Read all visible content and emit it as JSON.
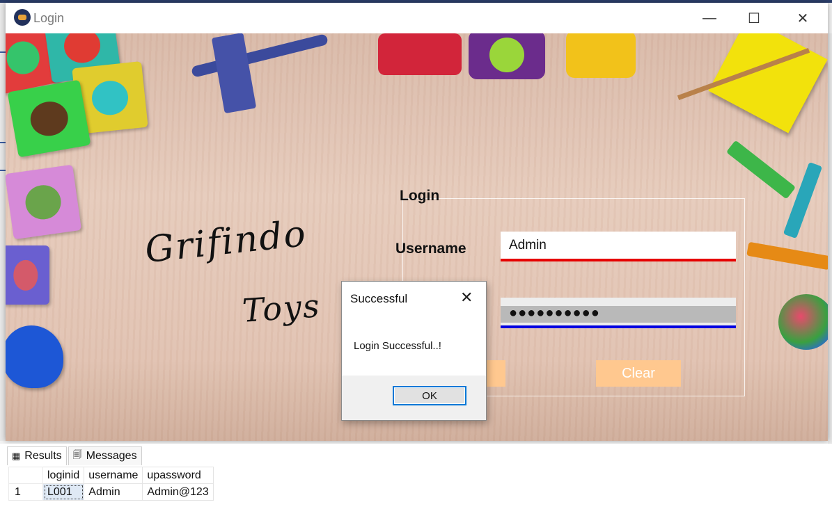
{
  "window": {
    "title": "Login",
    "minimize": "—",
    "maximize": "☐",
    "close": "✕"
  },
  "brand": {
    "line1": "Grifindo",
    "line2": "Toys"
  },
  "login": {
    "group_title": "Login",
    "username_label": "Username",
    "username_value": "Admin",
    "password_mask": "●●●●●●●●●●",
    "clear_label": "Clear",
    "colors": {
      "username_underline": "#e60000",
      "password_underline": "#0000e0",
      "button": "#ffc88f"
    }
  },
  "dialog": {
    "title": "Successful",
    "close": "✕",
    "message": "Login Successful..!",
    "ok_label": "OK"
  },
  "results": {
    "tabs": [
      {
        "label": "Results",
        "icon": "grid-icon"
      },
      {
        "label": "Messages",
        "icon": "messages-icon"
      }
    ],
    "columns": [
      "loginid",
      "username",
      "upassword"
    ],
    "rows": [
      {
        "num": "1",
        "loginid": "L001",
        "username": "Admin",
        "upassword": "Admin@123"
      }
    ]
  }
}
